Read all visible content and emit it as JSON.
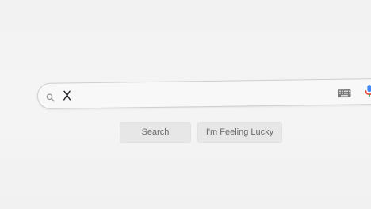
{
  "search": {
    "query": "X"
  },
  "buttons": {
    "search_label": "Search",
    "lucky_label": "I'm Feeling Lucky"
  },
  "icons": {
    "search": "search-icon",
    "keyboard": "keyboard-icon",
    "voice": "microphone-icon"
  },
  "colors": {
    "background": "#f2f2f2",
    "search_box_border": "#cfcfcf",
    "button_background": "#e7e7e7",
    "button_text": "#6b6b6b",
    "mic_blue": "#4285f4",
    "mic_red": "#ea4335"
  }
}
